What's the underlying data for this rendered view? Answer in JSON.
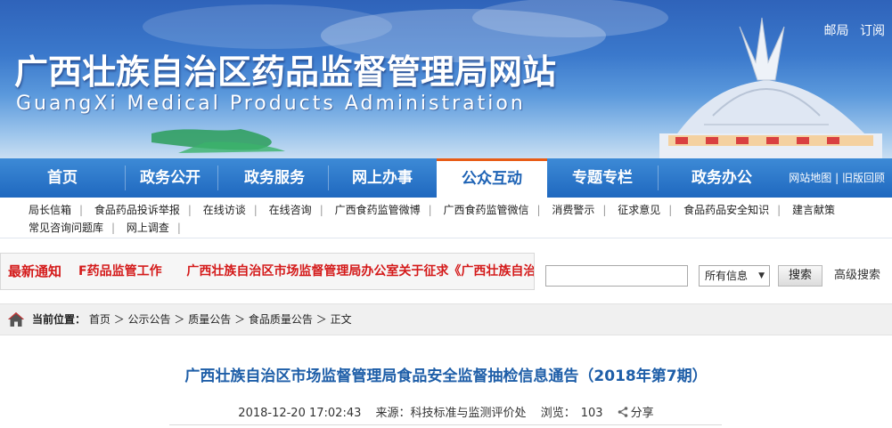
{
  "banner": {
    "title_cn": "广西壮族自治区药品监督管理局网站",
    "title_en": "GuangXi Medical Products Administration",
    "top_links": [
      "邮局",
      "订阅"
    ]
  },
  "main_nav": {
    "items": [
      "首页",
      "政务公开",
      "政务服务",
      "网上办事",
      "公众互动",
      "专题专栏",
      "政务办公"
    ],
    "active": "公众互动",
    "extra": [
      "网站地图",
      "旧版回顾"
    ]
  },
  "sub_nav": {
    "row1": [
      "局长信箱",
      "食品药品投诉举报",
      "在线访谈",
      "在线咨询",
      "广西食药监管微博",
      "广西食药监管微信",
      "消费警示",
      "征求意见",
      "食品药品安全知识",
      "建言献策"
    ],
    "row2": [
      "常见咨询问题库",
      "网上调查"
    ]
  },
  "notice": {
    "label": "最新通知",
    "items": [
      "F药品监管工作",
      "广西壮族自治区市场监督管理局办公室关于征求《广西壮族自治"
    ]
  },
  "search": {
    "value": "",
    "placeholder": "",
    "scope": "所有信息",
    "button": "搜索",
    "advanced": "高级搜索"
  },
  "breadcrumb": {
    "label": "当前位置：",
    "items": [
      "首页",
      "公示公告",
      "质量公告",
      "食品质量公告",
      "正文"
    ],
    "separator": "＞"
  },
  "article": {
    "title": "广西壮族自治区市场监督管理局食品安全监督抽检信息通告（2018年第7期）",
    "datetime": "2018-12-20 17:02:43",
    "source_label": "来源：",
    "source": "科技标准与监测评价处",
    "views_label": "浏览：",
    "views": "103",
    "share": "分享"
  },
  "icons": [
    "home-icon",
    "share-icon",
    "chevron-down-icon"
  ],
  "colors": {
    "nav_blue": "#1f68bf",
    "active_tab_border": "#e85c16",
    "notice_red": "#d41a1a",
    "title_blue": "#1e5ea8"
  }
}
